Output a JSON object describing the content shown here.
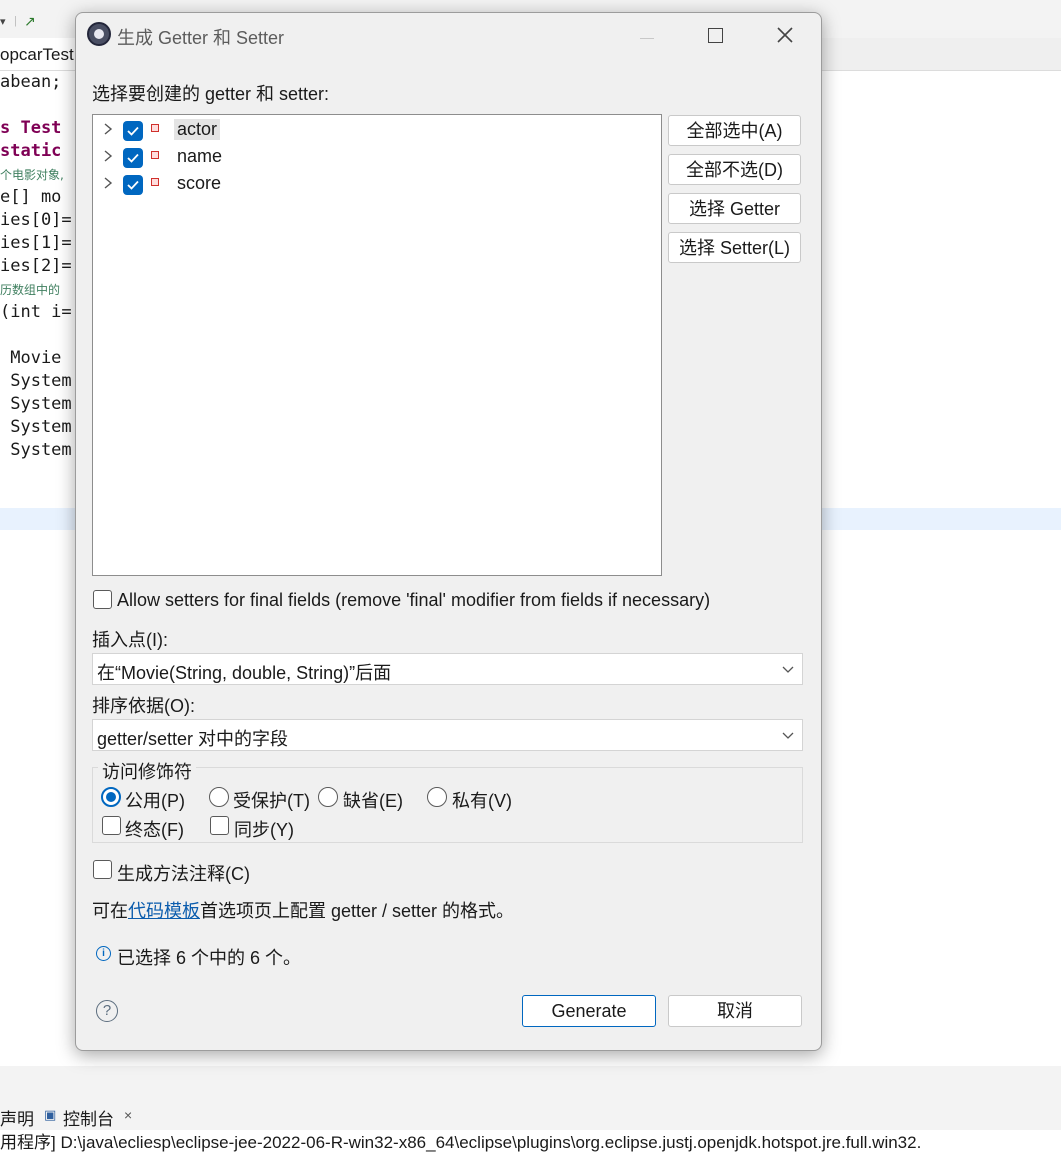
{
  "background": {
    "tab_label": "opcarTest",
    "code_lines": [
      {
        "parts": [
          {
            "t": "abean;",
            "c": ""
          }
        ]
      },
      {
        "parts": [
          {
            "t": "s Test",
            "c": "kw-lite"
          }
        ]
      },
      {
        "parts": [
          {
            "t": "static",
            "c": "kw"
          }
        ]
      },
      {
        "parts": [
          {
            "t": "个电影对象,",
            "c": "cmt"
          }
        ]
      },
      {
        "parts": [
          {
            "t": "e[] mo",
            "c": ""
          }
        ]
      },
      {
        "parts": [
          {
            "t": "ies[0]=",
            "c": ""
          }
        ]
      },
      {
        "parts": [
          {
            "t": "ies[1]=",
            "c": ""
          }
        ]
      },
      {
        "parts": [
          {
            "t": "ies[2]=",
            "c": ""
          }
        ]
      },
      {
        "parts": [
          {
            "t": "历数组中的",
            "c": "cmt"
          }
        ]
      },
      {
        "parts": [
          {
            "t": "(int i=",
            "c": ""
          }
        ]
      },
      {
        "parts": [
          {
            "t": "",
            "c": ""
          }
        ]
      },
      {
        "parts": [
          {
            "t": " Movie",
            "c": ""
          }
        ]
      },
      {
        "parts": [
          {
            "t": " System",
            "c": ""
          }
        ]
      },
      {
        "parts": [
          {
            "t": " System",
            "c": ""
          }
        ]
      },
      {
        "parts": [
          {
            "t": " System",
            "c": ""
          }
        ]
      },
      {
        "parts": [
          {
            "t": " System",
            "c": ""
          }
        ]
      }
    ],
    "panel_tab_declaration": "声明",
    "panel_tab_console": "控制台",
    "console_path": "用程序] D:\\java\\ecliesp\\eclipse-jee-2022-06-R-win32-x86_64\\eclipse\\plugins\\org.eclipse.justj.openjdk.hotspot.jre.full.win32."
  },
  "dialog": {
    "title": "生成 Getter 和 Setter",
    "prompt": "选择要创建的 getter 和 setter:",
    "fields": [
      {
        "name": "actor",
        "checked": true
      },
      {
        "name": "name",
        "checked": true
      },
      {
        "name": "score",
        "checked": true
      }
    ],
    "select_all_label": "全部选中(A)",
    "deselect_all_label": "全部不选(D)",
    "select_getters_label": "选择 Getter",
    "select_setters_label": "选择 Setter(L)",
    "allow_final_label": "Allow setters for final fields (remove 'final' modifier from fields if necessary)",
    "insertion_point_label": "插入点(I):",
    "insertion_point_value": "在“Movie(String, double, String)”后面",
    "sort_by_label": "排序依据(O):",
    "sort_by_value": "getter/setter 对中的字段",
    "access_modifier_title": "访问修饰符",
    "modifier_public": "公用(P)",
    "modifier_protected": "受保护(T)",
    "modifier_default": "缺省(E)",
    "modifier_private": "私有(V)",
    "modifier_final": "终态(F)",
    "modifier_synchronized": "同步(Y)",
    "generate_comments_label": "生成方法注释(C)",
    "template_prefix": "可在",
    "template_link": "代码模板",
    "template_suffix": "首选项页上配置 getter / setter 的格式。",
    "status_text": "已选择 6 个中的 6 个。",
    "generate_button": "Generate",
    "cancel_button": "取消"
  },
  "colors": {
    "accent": "#0067c0",
    "keyword": "#7f0055",
    "link": "#0b5cad"
  }
}
